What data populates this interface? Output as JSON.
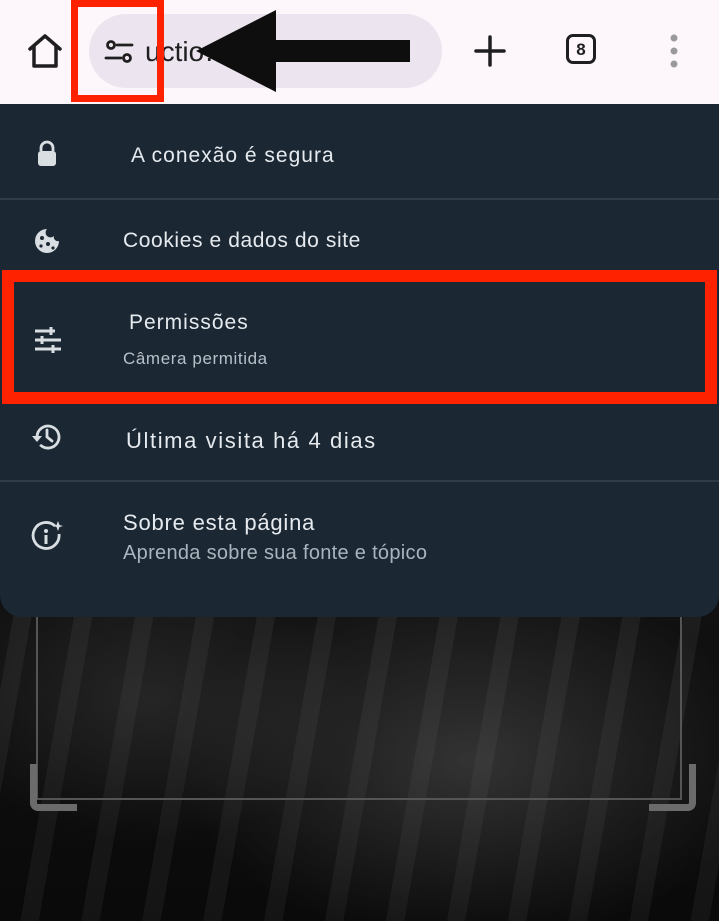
{
  "toolbar": {
    "url_text": "uctio……m.zoloz.net",
    "tab_count": "8"
  },
  "site_info_menu": {
    "connection": {
      "title": "A conexão é segura"
    },
    "cookies": {
      "title": "Cookies e dados do site"
    },
    "permissions": {
      "title": "Permissões",
      "subtitle": "Câmera permitida"
    },
    "last_visit": {
      "title": "Última visita há 4 dias"
    },
    "about": {
      "title": "Sobre esta página",
      "subtitle": "Aprenda sobre sua fonte e tópico"
    }
  },
  "icons": {
    "home": "home-icon",
    "site_settings": "tune-icon",
    "new_tab": "plus-icon",
    "tabs": "tab-switcher-icon",
    "menu": "more-vert-icon",
    "connection": "lock-icon",
    "cookies": "cookie-icon",
    "permissions": "sliders-icon",
    "last_visit": "history-icon",
    "about": "info-sparkle-icon"
  },
  "colors": {
    "toolbar_bg": "#fdf6fb",
    "panel_bg": "#1b2833",
    "annotation": "#ff2200"
  }
}
